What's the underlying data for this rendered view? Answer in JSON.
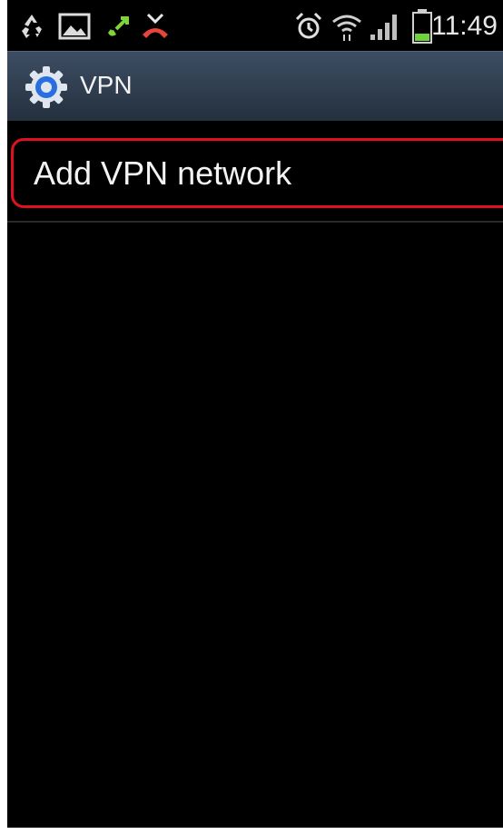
{
  "status_bar": {
    "time": "11:49",
    "left_icons": [
      "recycle-icon",
      "image-icon",
      "call-forward-icon",
      "missed-call-icon"
    ],
    "right_icons": [
      "alarm-icon",
      "wifi-icon",
      "signal-icon",
      "battery-icon"
    ]
  },
  "action_bar": {
    "icon": "settings-gear-icon",
    "title": "VPN"
  },
  "list": {
    "items": [
      {
        "label": "Add VPN network",
        "highlight_color": "#e01020"
      }
    ]
  },
  "colors": {
    "background": "#000000",
    "action_bar": "#2f3d4f",
    "gear_accent": "#2a6fe0",
    "highlight": "#e01020"
  }
}
